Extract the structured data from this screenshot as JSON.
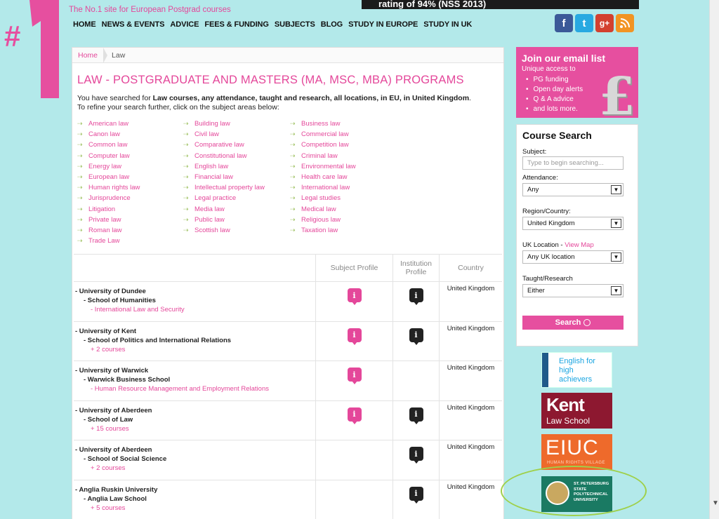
{
  "header": {
    "tagline": "The No.1 site for European Postgrad courses",
    "rating_banner": "rating of 94% (NSS 2013)",
    "nav": [
      "HOME",
      "NEWS & EVENTS",
      "ADVICE",
      "FEES & FUNDING",
      "SUBJECTS",
      "BLOG",
      "STUDY IN EUROPE",
      "STUDY IN UK"
    ],
    "social": {
      "facebook": "f",
      "twitter": "t",
      "google_plus": "g+",
      "rss": "rss"
    }
  },
  "breadcrumb": {
    "home": "Home",
    "current": "Law"
  },
  "main": {
    "title": "LAW - POSTGRADUATE AND MASTERS (MA, MSC, MBA) PROGRAMS",
    "intro_prefix": "You have searched for ",
    "intro_bold": "Law courses, any attendance, taught and research, all locations, in EU, in United Kingdom",
    "intro_suffix": ".",
    "intro_line2": "To refine your search further, click on the subject areas below:",
    "subjects": {
      "col1": [
        "American law",
        "Canon law",
        "Common law",
        "Computer law",
        "Energy law",
        "European law",
        "Human rights law",
        "Jurisprudence",
        "Litigation",
        "Private law",
        "Roman law",
        "Trade Law"
      ],
      "col2": [
        "Building law",
        "Civil law",
        "Comparative law",
        "Constitutional law",
        "English law",
        "Financial law",
        "Intellectual property law",
        "Legal practice",
        "Media law",
        "Public law",
        "Scottish law"
      ],
      "col3": [
        "Business law",
        "Commercial law",
        "Competition law",
        "Criminal law",
        "Environmental law",
        "Health care law",
        "International law",
        "Legal studies",
        "Medical law",
        "Religious law",
        "Taxation law"
      ]
    },
    "table": {
      "headers": {
        "subject_profile": "Subject Profile",
        "institution_profile": "Institution Profile",
        "country": "Country"
      },
      "rows": [
        {
          "university": "- University of Dundee",
          "school": "- School of Humanities",
          "course": "- International Law and Security",
          "subject_profile": true,
          "institution_profile": true,
          "country": "United Kingdom"
        },
        {
          "university": "- University of Kent",
          "school": "- School of Politics and International Relations",
          "course": "+ 2 courses",
          "subject_profile": true,
          "institution_profile": true,
          "country": "United Kingdom"
        },
        {
          "university": "- University of Warwick",
          "school": "- Warwick Business School",
          "course": "- Human Resource Management and Employment Relations",
          "subject_profile": true,
          "institution_profile": false,
          "country": "United Kingdom"
        },
        {
          "university": "- University of Aberdeen",
          "school": "- School of Law",
          "course": "+ 15 courses",
          "subject_profile": true,
          "institution_profile": true,
          "country": "United Kingdom"
        },
        {
          "university": "- University of Aberdeen",
          "school": "- School of Social Science",
          "course": "+ 2 courses",
          "subject_profile": false,
          "institution_profile": true,
          "country": "United Kingdom"
        },
        {
          "university": "- Anglia Ruskin University",
          "school": "- Anglia Law School",
          "course": "+ 5 courses",
          "subject_profile": false,
          "institution_profile": true,
          "country": "United Kingdom"
        }
      ],
      "info_glyph": "i"
    }
  },
  "email_box": {
    "title": "Join our email list",
    "subtitle": "Unique access to",
    "items": [
      "PG funding",
      "Open day alerts",
      "Q & A advice",
      "and lots more."
    ],
    "symbol": "£"
  },
  "course_search": {
    "title": "Course Search",
    "subject_label": "Subject:",
    "subject_placeholder": "Type to begin searching...",
    "attendance_label": "Attendance:",
    "attendance_value": "Any",
    "region_label": "Region/Country:",
    "region_value": "United Kingdom",
    "uk_location_label": "UK Location - ",
    "view_map": "View Map",
    "uk_location_value": "Any UK location",
    "taught_label": "Taught/Research",
    "taught_value": "Either",
    "search_button": "Search"
  },
  "ads": {
    "english": "English for high achievers",
    "kent_big": "Kent",
    "kent_small": "Law School",
    "eiuc": "EIUC",
    "eiuc_sub": "HUMAN RIGHTS VILLAGE",
    "spb": "ST. PETERSBURG STATE POLYTECHNICAL UNIVERSITY"
  },
  "colors": {
    "accent": "#e4479a",
    "background": "#b3e9ea",
    "ring": "#9fd04a"
  }
}
